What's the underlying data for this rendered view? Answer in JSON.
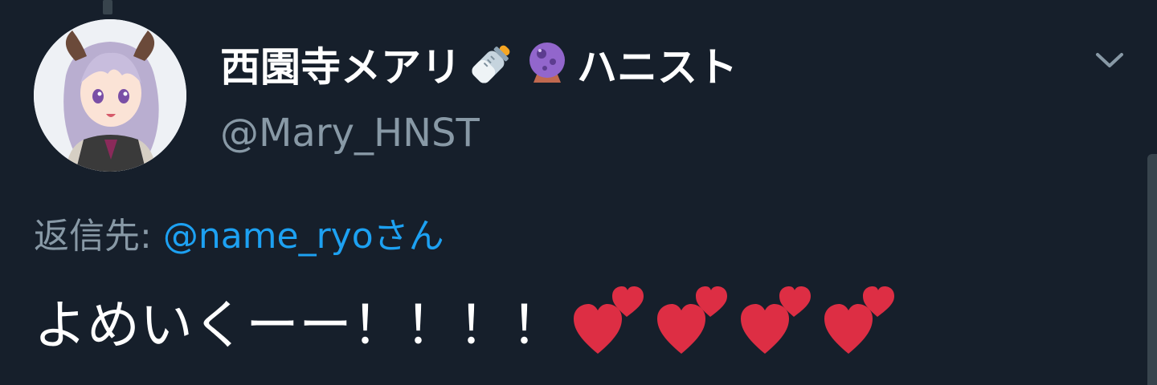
{
  "tweet": {
    "display_name": "西園寺メアリ",
    "display_name_suffix": "ハニスト",
    "name_emojis": [
      "baby-bottle-icon",
      "crystal-ball-icon"
    ],
    "handle": "@Mary_HNST",
    "reply_label": "返信先: ",
    "reply_to": "@name_ryoさん",
    "text": "よめいくーー！！！！",
    "text_emojis": [
      "two-hearts-icon",
      "two-hearts-icon",
      "two-hearts-icon",
      "two-hearts-icon"
    ]
  },
  "colors": {
    "background": "#161f2b",
    "primary_text": "#ffffff",
    "secondary_text": "#8899a6",
    "link": "#1da1f2",
    "heart": "#dd2e44"
  }
}
